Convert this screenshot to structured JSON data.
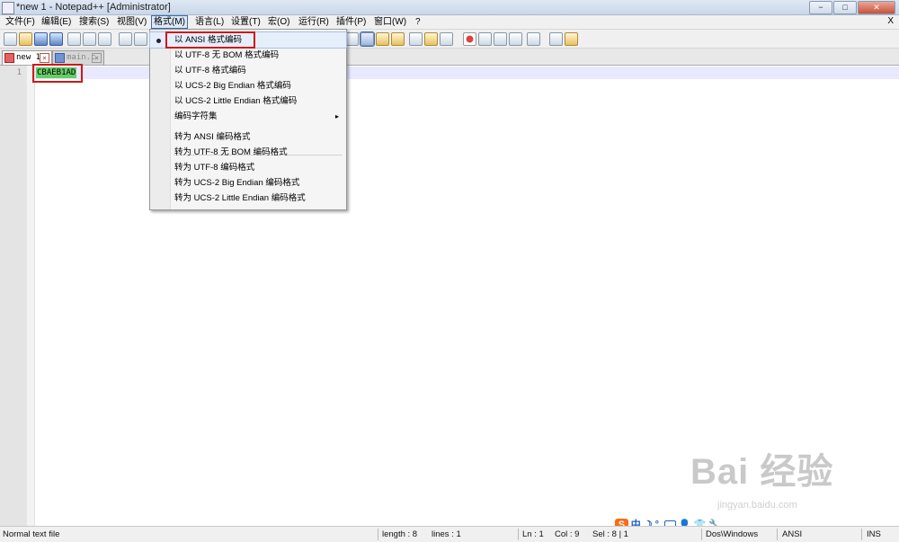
{
  "window": {
    "title": "*new 1 - Notepad++ [Administrator]",
    "buttons": [
      "−",
      "□",
      "✕"
    ]
  },
  "menubar": {
    "items": [
      "文件(F)",
      "编辑(E)",
      "搜索(S)",
      "视图(V)",
      "格式(M)",
      "语言(L)",
      "设置(T)",
      "宏(O)",
      "运行(R)",
      "插件(P)",
      "窗口(W)",
      "?"
    ],
    "active_index": 4,
    "close": "X"
  },
  "tabs": [
    {
      "label": "new 1",
      "active": true
    },
    {
      "label": "main.c",
      "active": false
    }
  ],
  "editor": {
    "line_numbers": [
      "1"
    ],
    "lines": [
      "CBAEB1AD"
    ],
    "selection_color": "#66cc66"
  },
  "format_menu": {
    "items": [
      {
        "label": "以 ANSI 格式编码",
        "checked": true
      },
      {
        "label": "以 UTF-8 无 BOM 格式编码"
      },
      {
        "label": "以 UTF-8 格式编码"
      },
      {
        "label": "以 UCS-2 Big Endian 格式编码"
      },
      {
        "label": "以 UCS-2 Little Endian 格式编码"
      },
      {
        "label": "编码字符集",
        "submenu": true
      },
      {
        "label": "转为 ANSI 编码格式"
      },
      {
        "label": "转为 UTF-8 无 BOM 编码格式"
      },
      {
        "label": "转为 UTF-8 编码格式"
      },
      {
        "label": "转为 UCS-2 Big Endian 编码格式"
      },
      {
        "label": "转为 UCS-2 Little Endian 编码格式"
      }
    ],
    "submenu_arrow": "▸",
    "highlight_color": "#d01818"
  },
  "statusbar": {
    "file_type": "Normal text file",
    "length": "length : 8",
    "lines": "lines : 1",
    "ln": "Ln : 1",
    "col": "Col : 9",
    "sel": "Sel : 8 | 1",
    "eol": "Dos\\Windows",
    "encoding": "ANSI",
    "mode": "INS"
  },
  "ime": {
    "logo": "S",
    "mode": "中",
    "glyphs": [
      "☽",
      "°,",
      "⌨",
      "👤",
      "👕",
      "🔧"
    ]
  },
  "watermark": {
    "text": "Bai 经验",
    "url": "jingyan.baidu.com"
  }
}
